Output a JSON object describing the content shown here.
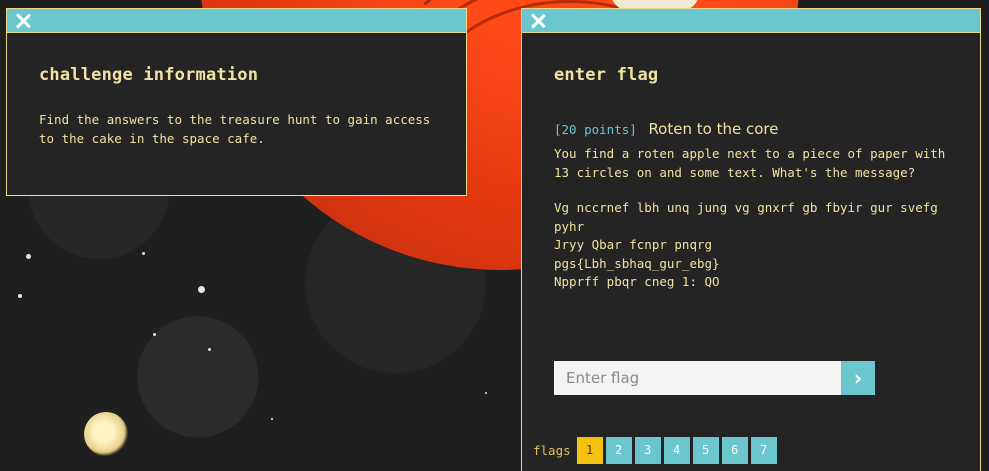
{
  "info_panel": {
    "title": "challenge information",
    "description": "Find the answers to the treasure hunt to gain access to the cake in the space cafe."
  },
  "flag_panel": {
    "title": "enter flag",
    "points": "[20 points]",
    "challenge_name": "Roten to the core",
    "description": "You find a roten apple next to a piece of paper with 13 circles on and some text. What's the message?",
    "cipher_lines": [
      "Vg nccrnef lbh unq jung vg gnxrf gb fbyir gur svefg pyhr",
      "Jryy Qbar fcnpr pnqrg",
      "pgs{Lbh_sbhaq_gur_ebg}",
      "Npprff pbqr cneg 1: QO"
    ],
    "input_placeholder": "Enter flag",
    "submit_icon": "chevron-right-icon",
    "flags_label": "flags",
    "flag_tabs": [
      "1",
      "2",
      "3",
      "4",
      "5",
      "6",
      "7"
    ],
    "active_tab": "1"
  },
  "colors": {
    "accent": "#6cc6cd",
    "text": "#f2e2a2",
    "active_tab": "#f4c20e",
    "panel_bg": "#242424",
    "planet": "#e83a12"
  }
}
